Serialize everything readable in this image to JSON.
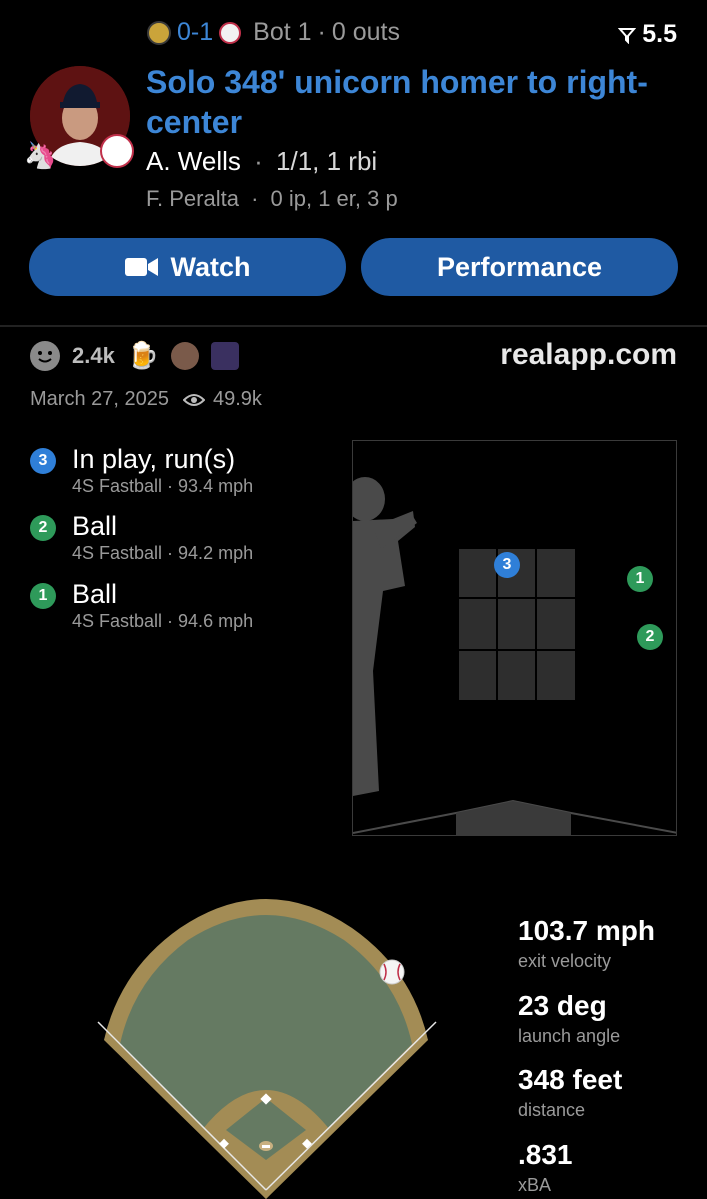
{
  "header": {
    "score": "0-1",
    "inning": "Bot 1",
    "outs": "0 outs",
    "fav_count": "5.5",
    "title": "Solo 348' unicorn homer to right-center",
    "batter_name": "A. Wells",
    "batter_line": "1/1, 1 rbi",
    "pitcher_name": "F. Peralta",
    "pitcher_line": "0 ip, 1 er, 3 p"
  },
  "buttons": {
    "watch": "Watch",
    "performance": "Performance"
  },
  "social": {
    "reactions": "2.4k",
    "brand": "realapp.com",
    "date": "March 27, 2025",
    "views": "49.9k"
  },
  "pitches": [
    {
      "num": "3",
      "result": "In play, run(s)",
      "detail": "4S Fastball · 93.4 mph",
      "color": "#2f7fd8"
    },
    {
      "num": "2",
      "result": "Ball",
      "detail": "4S Fastball · 94.2 mph",
      "color": "#2e9a5a"
    },
    {
      "num": "1",
      "result": "Ball",
      "detail": "4S Fastball · 94.6 mph",
      "color": "#2e9a5a"
    }
  ],
  "stats": [
    {
      "value": "103.7 mph",
      "label": "exit velocity"
    },
    {
      "value": "23 deg",
      "label": "launch angle"
    },
    {
      "value": "348 feet",
      "label": "distance"
    },
    {
      "value": ".831",
      "label": "xBA"
    }
  ],
  "colors": {
    "accent": "#3d86d6",
    "button": "#1f5aa3",
    "ball_green": "#2e9a5a",
    "in_play_blue": "#2f7fd8"
  }
}
